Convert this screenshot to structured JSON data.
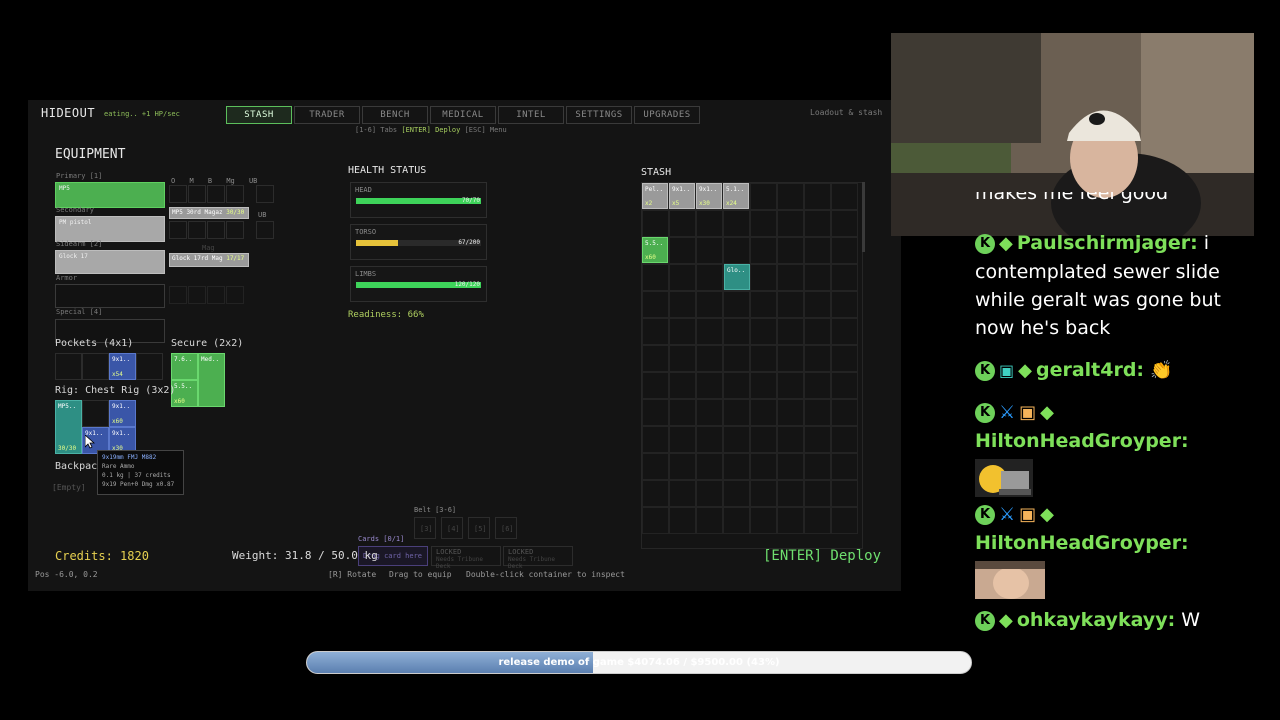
{
  "game": {
    "title": "HIDEOUT",
    "subtitle": "eating.. +1 HP/sec",
    "tabs": [
      {
        "label": "STASH",
        "active": true
      },
      {
        "label": "TRADER",
        "active": false
      },
      {
        "label": "BENCH",
        "active": false
      },
      {
        "label": "MEDICAL",
        "active": false
      },
      {
        "label": "INTEL",
        "active": false
      },
      {
        "label": "SETTINGS",
        "active": false
      },
      {
        "label": "UPGRADES",
        "active": false
      }
    ],
    "tab_hint": {
      "prefix": "[1-6] Tabs ",
      "enter": "[ENTER] Deploy",
      "esc": "[ESC] Menu"
    },
    "top_right": "Loadout & stash",
    "equipment": {
      "title": "EQUIPMENT",
      "primary_label": "Primary [1]",
      "primary_item": "MP5",
      "secondary_label": "Secondary",
      "secondary_item": "PM pistol",
      "sidearm_label": "Sidearm [2]",
      "sidearm_item": "Glock 17",
      "armor_label": "Armor",
      "special_label": "Special [4]",
      "attach_headers": [
        "O",
        "M",
        "B",
        "Mg",
        "UB"
      ],
      "primary_mag": {
        "name": "MP5 30rd Magaz",
        "count": "30/30"
      },
      "secondary_attach_label": "UB",
      "sidearm_mag": {
        "name": "Glock 17rd Mag",
        "count": "17/17"
      },
      "sidearm_empty": "Mag"
    },
    "pockets": {
      "title": "Pockets (4x1)",
      "item": {
        "name": "9x1..",
        "count": "x54"
      }
    },
    "secure": {
      "title": "Secure (2x2)",
      "items": [
        {
          "name": "7.6..",
          "count": ""
        },
        {
          "name": "Med..",
          "count": ""
        },
        {
          "name": "5.5..",
          "count": "x60"
        }
      ]
    },
    "rig": {
      "title": "Rig: Chest Rig (3x2)",
      "items": [
        {
          "name": "MP5..",
          "count": "30/30"
        },
        {
          "name": "9x1..",
          "count": "x60"
        },
        {
          "name": "9x1..",
          "count": ""
        },
        {
          "name": "9x1..",
          "count": "x30"
        }
      ]
    },
    "backpack": {
      "title": "Backpack",
      "empty": "[Empty]"
    },
    "tooltip": {
      "name": "9x19mm FMJ M882",
      "rarity": "Rare Ammo",
      "stats": "0.1 kg | 37 credits",
      "detail": "9x19  Pen+0  Dmg x0.87"
    },
    "health": {
      "title": "HEALTH STATUS",
      "parts": [
        {
          "name": "HEAD",
          "value": "70/70",
          "fraction": 1.0,
          "color": "#3ed35a"
        },
        {
          "name": "TORSO",
          "value": "67/200",
          "fraction": 0.335,
          "color": "#e6c23a"
        },
        {
          "name": "LIMBS",
          "value": "120/120",
          "fraction": 1.0,
          "color": "#3ed35a"
        }
      ],
      "readiness": "Readiness: 66%"
    },
    "stash": {
      "title": "STASH",
      "items": [
        {
          "name": "Pel..",
          "count": "x2"
        },
        {
          "name": "9x1..",
          "count": "x5"
        },
        {
          "name": "9x1..",
          "count": "x30"
        },
        {
          "name": "5.1..",
          "count": "x24"
        },
        {
          "name": "5.5..",
          "count": "x60"
        },
        {
          "name": "Glo..",
          "count": ""
        }
      ]
    },
    "belt": {
      "title": "Belt [3-6]",
      "slots": [
        "[3]",
        "[4]",
        "[5]",
        "[6]"
      ]
    },
    "cards": {
      "title": "Cards [0/1]",
      "drop_hint": "Drag card here",
      "locked": "LOCKED",
      "locked_sub": "Needs Tribune Deck"
    },
    "credits": "Credits: 1820",
    "weight": "Weight: 31.8 / 50.0 kg",
    "deploy": "[ENTER] Deploy",
    "bottom_hints": [
      "[R] Rotate",
      "Drag to equip",
      "Double-click container to inspect"
    ],
    "pos": "Pos -6.0, 0.2"
  },
  "chat": {
    "partial_top": "makes me feel good",
    "messages": [
      {
        "user": "Paulschirmjager:",
        "text": "i contemplated sewer slide while geralt was gone but now he's back"
      },
      {
        "user": "geralt4rd:",
        "text": ""
      },
      {
        "user": "HiltonHeadGroyper:",
        "text": ""
      },
      {
        "user": "HiltonHeadGroyper:",
        "text": ""
      },
      {
        "user": "ohkaykaykayy:",
        "text": "W"
      }
    ],
    "badge_letter": "K"
  },
  "goal": {
    "text": "release demo of game $4074.06 / $9500.00 (43%)",
    "fraction": 0.43
  }
}
